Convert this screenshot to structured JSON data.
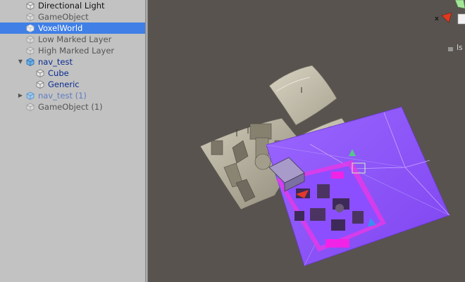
{
  "hierarchy": {
    "items": [
      {
        "label": "Directional Light",
        "style": "active"
      },
      {
        "label": "GameObject",
        "style": "inactive"
      },
      {
        "label": "VoxelWorld",
        "style": "selected"
      },
      {
        "label": "Low Marked Layer",
        "style": "inactive"
      },
      {
        "label": "High Marked Layer",
        "style": "inactive"
      },
      {
        "label": "nav_test",
        "style": "prefab",
        "expanded": true
      },
      {
        "label": "Cube",
        "style": "prefab",
        "child": true
      },
      {
        "label": "Generic",
        "style": "prefab",
        "child": true
      },
      {
        "label": "nav_test (1)",
        "style": "prefab-dim",
        "expanded": false
      },
      {
        "label": "GameObject (1)",
        "style": "inactive"
      }
    ]
  },
  "scene": {
    "gizmo": {
      "x_axis_label": "x",
      "projection_label": "Is"
    },
    "colors": {
      "background": "#58534f",
      "terrain": "#c9c4b2",
      "navmesh": "#8a52f5",
      "marked": "#f023e6",
      "selection": "#3f7fe6"
    }
  }
}
